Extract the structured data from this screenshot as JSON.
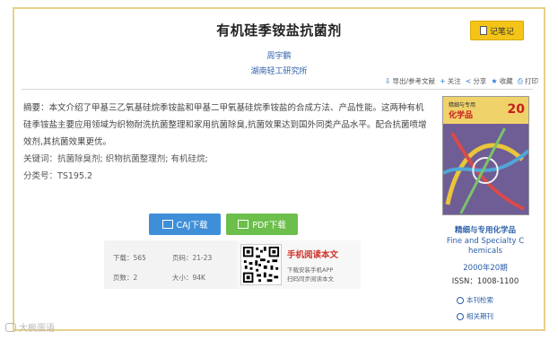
{
  "article": {
    "title": "有机硅季铵盐抗菌剂",
    "author": "周宇鹏",
    "org": "湖南轻工研究所",
    "abstract": "摘要：本文介绍了甲基三乙氧基硅烷季铵盐和甲基二甲氧基硅烷季铵盐的合成方法、产品性能。这两种有机硅季铵盐主要应用领域为织物耐洗抗菌整理和家用抗菌除臭,抗菌效果达到国外同类产品水平。配合抗菌喷增效剂,其抗菌效果更优。",
    "keywords_label": "关键词：",
    "keywords": "抗菌除臭剂; 织物抗菌整理剂; 有机硅烷;",
    "class_label": "分类号：",
    "class_no": "TS195.2"
  },
  "toolbar": {
    "note_label": "记笔记",
    "export": "导出/参考文献",
    "follow": "关注",
    "share": "分享",
    "favorite": "收藏",
    "print": "打印"
  },
  "downloads": {
    "caj_label": "CAJ下载",
    "pdf_label": "PDF下载"
  },
  "stats": {
    "downloads_label": "下载：",
    "downloads_value": "565",
    "pages_label": "页码：",
    "pages_value": "21-23",
    "page_count_label": "页数：",
    "page_count_value": "2",
    "size_label": "大小：",
    "size_value": "94K"
  },
  "mobile": {
    "title": "手机阅读本文",
    "sub1": "下载安装手机APP",
    "sub2": "扫码同步阅读本文"
  },
  "journal": {
    "cover_t1": "精细与专用",
    "cover_t2": "化学品",
    "cover_num": "20",
    "name": "精细与专用化学品",
    "english_line1": "Fine and Specialty C",
    "english_line2": "hemicals",
    "issue": "2000年20期",
    "issn": "ISSN：1008-1100",
    "link1": "本刊检索",
    "link2": "相关期刊"
  },
  "watermark": "大枫蛋语"
}
